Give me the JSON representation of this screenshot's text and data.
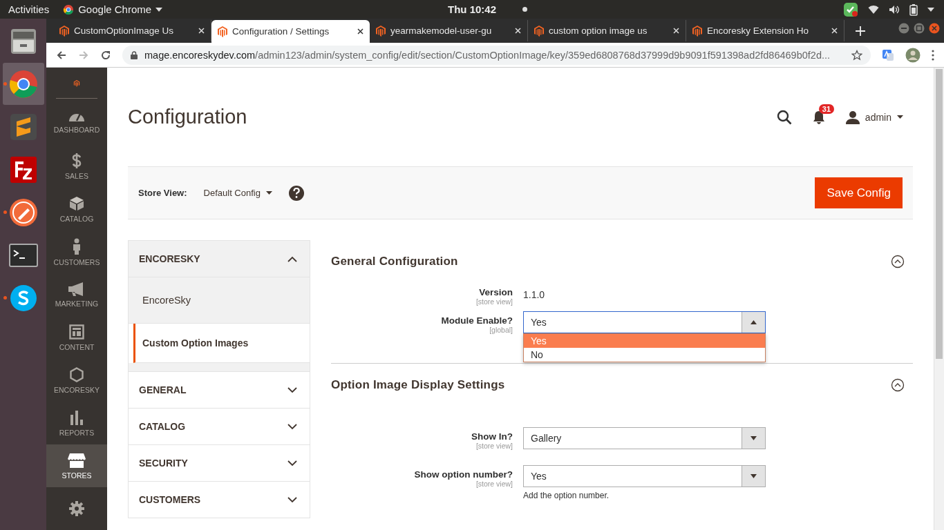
{
  "top_bar": {
    "activities": "Activities",
    "app_name": "Google Chrome",
    "clock": "Thu 10:42"
  },
  "dock": [
    {
      "kind": "files",
      "running": false,
      "selected": false
    },
    {
      "kind": "chrome",
      "running": true,
      "selected": true
    },
    {
      "kind": "sublime",
      "running": false,
      "selected": false
    },
    {
      "kind": "filezilla",
      "running": false,
      "selected": false
    },
    {
      "kind": "postman",
      "running": true,
      "selected": false
    },
    {
      "kind": "terminal",
      "running": false,
      "selected": false
    },
    {
      "kind": "skype",
      "running": true,
      "selected": false
    }
  ],
  "browser": {
    "tabs": [
      {
        "title": "CustomOptionImage Us",
        "selected": false
      },
      {
        "title": "Configuration / Settings",
        "selected": true
      },
      {
        "title": "yearmakemodel-user-gu",
        "selected": false
      },
      {
        "title": "custom option image us",
        "selected": false
      },
      {
        "title": "Encoresky Extension Ho",
        "selected": false
      }
    ],
    "url_host": "mage.encoreskydev.com",
    "url_path": "/admin123/admin/system_config/edit/section/CustomOptionImage/key/359ed6808768d37999d9b9091f591398ad2fd86469b0f2d..."
  },
  "admin_menu": [
    {
      "label": "DASHBOARD",
      "kind": "dashboard",
      "selected": false
    },
    {
      "label": "SALES",
      "kind": "sales",
      "selected": false
    },
    {
      "label": "CATALOG",
      "kind": "catalog",
      "selected": false
    },
    {
      "label": "CUSTOMERS",
      "kind": "customers",
      "selected": false
    },
    {
      "label": "MARKETING",
      "kind": "marketing",
      "selected": false
    },
    {
      "label": "CONTENT",
      "kind": "content",
      "selected": false
    },
    {
      "label": "ENCORESKY",
      "kind": "encoresky",
      "selected": false
    },
    {
      "label": "REPORTS",
      "kind": "reports",
      "selected": false
    },
    {
      "label": "STORES",
      "kind": "stores",
      "selected": true
    },
    {
      "kind": "system",
      "selected": false
    }
  ],
  "page_title": "Configuration",
  "header": {
    "notifications": "31",
    "user": "admin"
  },
  "store_view": {
    "label": "Store View:",
    "value": "Default Config"
  },
  "save_button": "Save Config",
  "config_nav": [
    {
      "title": "ENCORESKY",
      "expanded": true,
      "children": [
        {
          "label": "EncoreSky",
          "selected": false
        },
        {
          "label": "Custom Option Images",
          "selected": true
        }
      ]
    },
    {
      "title": "GENERAL",
      "expanded": false
    },
    {
      "title": "CATALOG",
      "expanded": false
    },
    {
      "title": "SECURITY",
      "expanded": false
    },
    {
      "title": "CUSTOMERS",
      "expanded": false
    }
  ],
  "groups": [
    {
      "title": "General Configuration",
      "expanded": true,
      "fields": [
        {
          "kind": "text",
          "label": "Version",
          "scope": "[store view]",
          "value": "1.1.0"
        },
        {
          "kind": "select",
          "label": "Module Enable?",
          "scope": "[global]",
          "value": "Yes",
          "open": true,
          "options": [
            {
              "label": "Yes",
              "selected": true
            },
            {
              "label": "No",
              "selected": false
            }
          ]
        }
      ]
    },
    {
      "title": "Option Image Display Settings",
      "expanded": true,
      "fields": [
        {
          "kind": "select",
          "label": "Show In?",
          "scope": "[store view]",
          "value": "Gallery",
          "open": false
        },
        {
          "kind": "select",
          "label": "Show option number?",
          "scope": "[store view]",
          "value": "Yes",
          "open": false,
          "note": "Add the option number."
        }
      ]
    }
  ]
}
